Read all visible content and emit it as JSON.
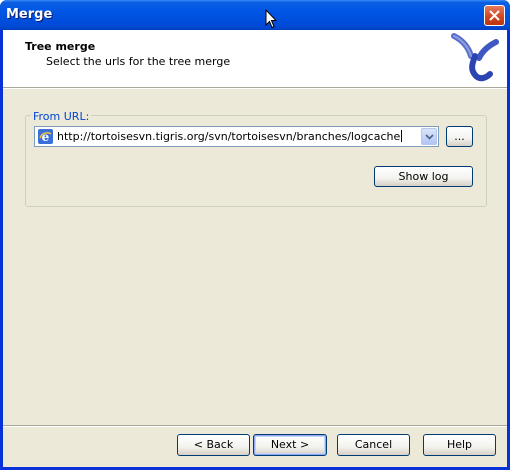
{
  "window": {
    "title": "Merge",
    "close_icon": "close-icon"
  },
  "header": {
    "title": "Tree merge",
    "subtitle": "Select the urls for the tree merge",
    "logo_icon": "tortoisesvn-merge-logo"
  },
  "group": {
    "label": "From URL:"
  },
  "url_combo": {
    "value": "http://tortoisesvn.tigris.org/svn/tortoisesvn/branches/logcache",
    "icon": "internet-explorer-icon"
  },
  "buttons": {
    "browse": "...",
    "show_log": "Show log",
    "back": "< Back",
    "next": "Next >",
    "cancel": "Cancel",
    "help": "Help"
  },
  "colors": {
    "titlebar": "#0055e5",
    "face": "#ece9d8",
    "group_label": "#0046d5"
  }
}
